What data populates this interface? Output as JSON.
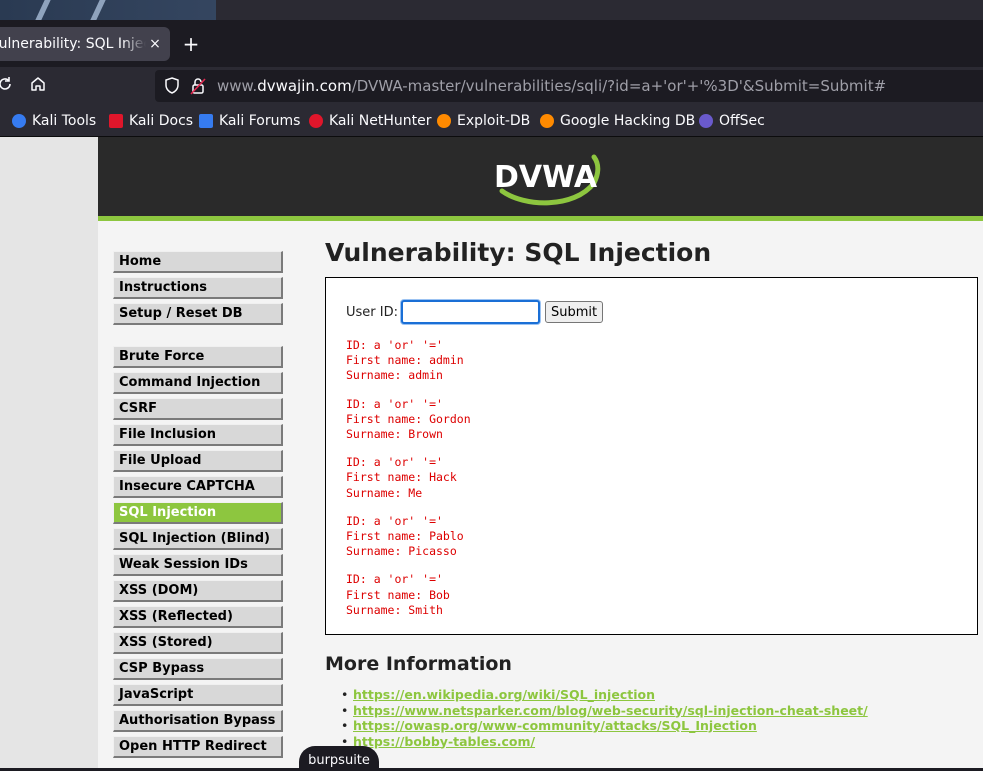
{
  "browser": {
    "tab_title": "Vulnerability: SQL Injection",
    "tab_close": "×",
    "new_tab": "+",
    "url_prefix": "www.",
    "url_host": "dvwajin.com",
    "url_path": "/DVWA-master/vulnerabilities/sqli/?id=a+'or'+'%3D'&Submit=Submit#",
    "bookmarks": [
      {
        "label": "Kali Tools",
        "icon": "kali-tools-icon",
        "color": "#367bf0"
      },
      {
        "label": "Kali Docs",
        "icon": "kali-docs-icon",
        "color": "#e0162b"
      },
      {
        "label": "Kali Forums",
        "icon": "kali-forums-icon",
        "color": "#367bf0"
      },
      {
        "label": "Kali NetHunter",
        "icon": "kali-nethunter-icon",
        "color": "#e0162b"
      },
      {
        "label": "Exploit-DB",
        "icon": "exploit-db-icon",
        "color": "#ff8a00"
      },
      {
        "label": "Google Hacking DB",
        "icon": "ghdb-icon",
        "color": "#ff8a00"
      },
      {
        "label": "OffSec",
        "icon": "offsec-icon",
        "color": "#6a5acd"
      }
    ]
  },
  "dvwa": {
    "logo_text": "DVWA",
    "accent": "#8dc63f",
    "menu": [
      {
        "label": "Home"
      },
      {
        "label": "Instructions"
      },
      {
        "label": "Setup / Reset DB"
      },
      {
        "label": "Brute Force"
      },
      {
        "label": "Command Injection"
      },
      {
        "label": "CSRF"
      },
      {
        "label": "File Inclusion"
      },
      {
        "label": "File Upload"
      },
      {
        "label": "Insecure CAPTCHA"
      },
      {
        "label": "SQL Injection",
        "active": true
      },
      {
        "label": "SQL Injection (Blind)"
      },
      {
        "label": "Weak Session IDs"
      },
      {
        "label": "XSS (DOM)"
      },
      {
        "label": "XSS (Reflected)"
      },
      {
        "label": "XSS (Stored)"
      },
      {
        "label": "CSP Bypass"
      },
      {
        "label": "JavaScript"
      },
      {
        "label": "Authorisation Bypass"
      },
      {
        "label": "Open HTTP Redirect"
      }
    ],
    "page_title": "Vulnerability: SQL Injection",
    "form": {
      "label": "User ID:",
      "value": "",
      "submit": "Submit"
    },
    "results": [
      {
        "id": "ID: a 'or' '='",
        "first": "First name: admin",
        "surname": "Surname: admin"
      },
      {
        "id": "ID: a 'or' '='",
        "first": "First name: Gordon",
        "surname": "Surname: Brown"
      },
      {
        "id": "ID: a 'or' '='",
        "first": "First name: Hack",
        "surname": "Surname: Me"
      },
      {
        "id": "ID: a 'or' '='",
        "first": "First name: Pablo",
        "surname": "Surname: Picasso"
      },
      {
        "id": "ID: a 'or' '='",
        "first": "First name: Bob",
        "surname": "Surname: Smith"
      }
    ],
    "more_info_title": "More Information",
    "links": [
      "https://en.wikipedia.org/wiki/SQL_injection",
      "https://www.netsparker.com/blog/web-security/sql-injection-cheat-sheet/",
      "https://owasp.org/www-community/attacks/SQL_Injection",
      "https://bobby-tables.com/"
    ]
  },
  "tooltip": "burpsuite"
}
